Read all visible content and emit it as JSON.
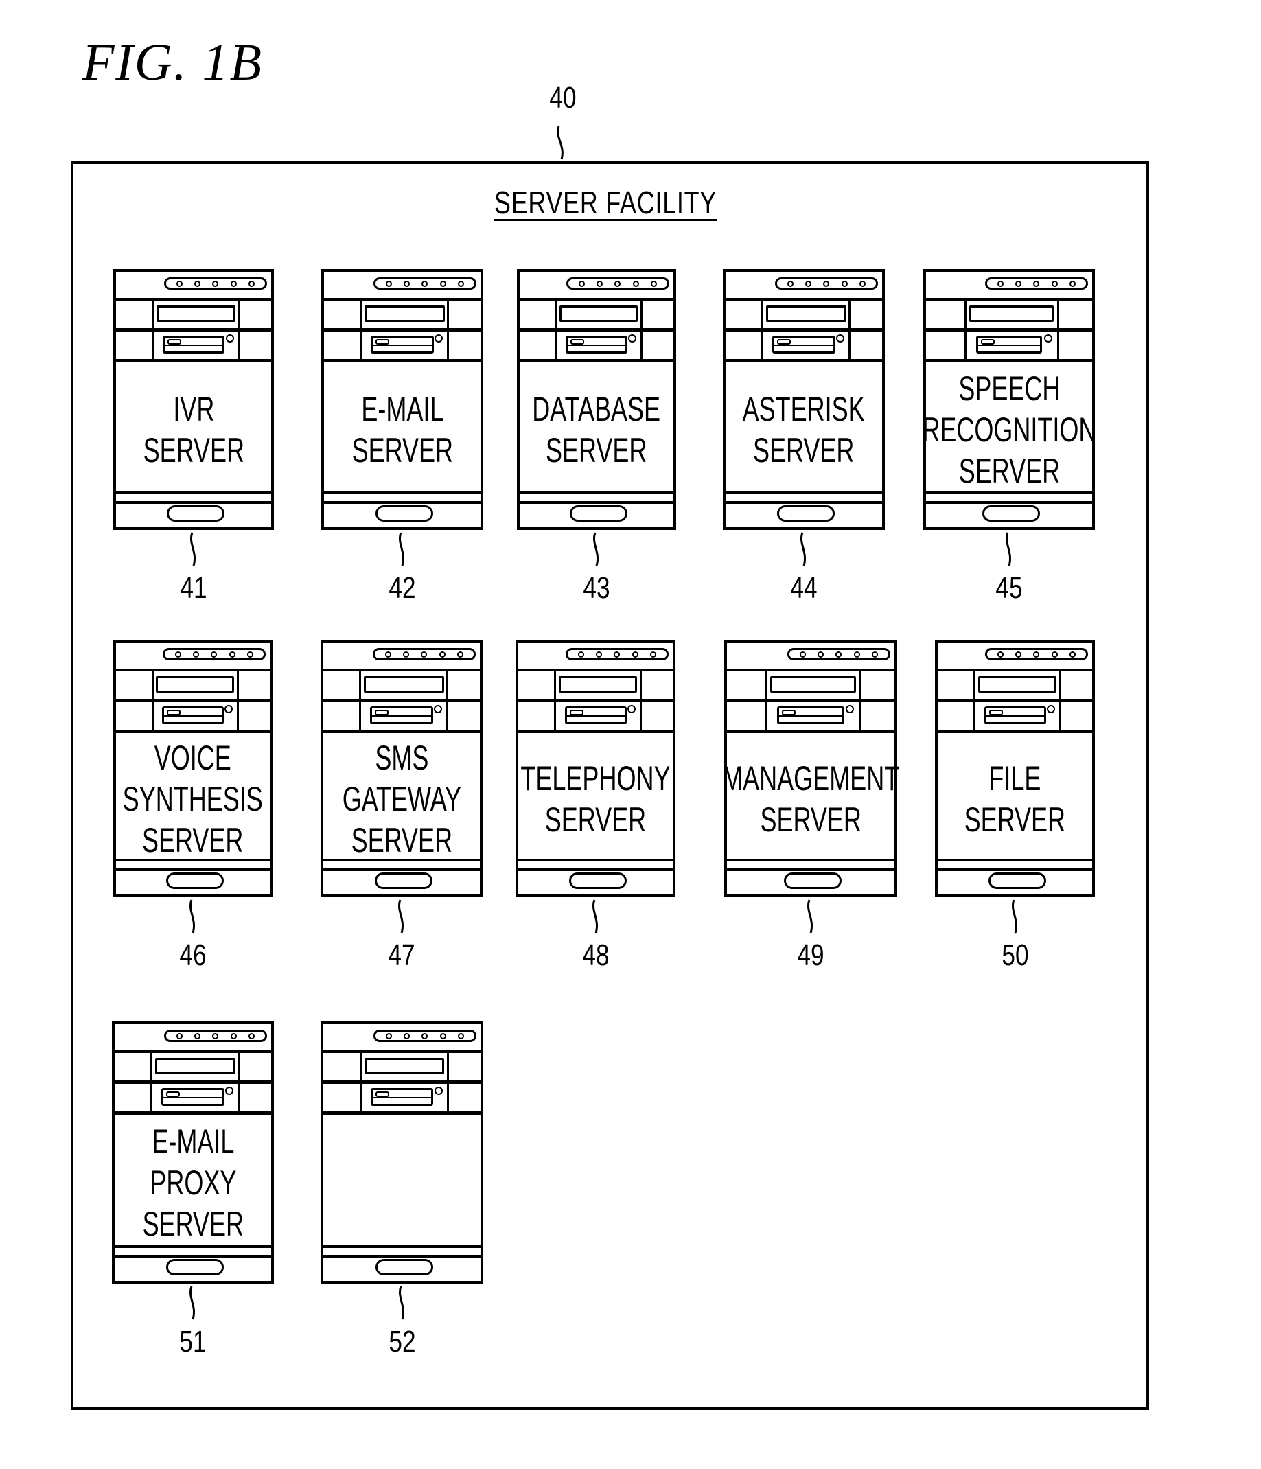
{
  "figure": {
    "title": "FIG. 1B",
    "facility": {
      "ref": "40",
      "title": "SERVER FACILITY"
    },
    "servers": [
      {
        "ref": "41",
        "label": "IVR\nSERVER"
      },
      {
        "ref": "42",
        "label": "E-MAIL\nSERVER"
      },
      {
        "ref": "43",
        "label": "DATABASE\nSERVER"
      },
      {
        "ref": "44",
        "label": "ASTERISK\nSERVER"
      },
      {
        "ref": "45",
        "label": "SPEECH\nRECOGNITION\nSERVER"
      },
      {
        "ref": "46",
        "label": "VOICE\nSYNTHESIS\nSERVER"
      },
      {
        "ref": "47",
        "label": "SMS\nGATEWAY\nSERVER"
      },
      {
        "ref": "48",
        "label": "TELEPHONY\nSERVER"
      },
      {
        "ref": "49",
        "label": "MANAGEMENT\nSERVER"
      },
      {
        "ref": "50",
        "label": "FILE\nSERVER"
      },
      {
        "ref": "51",
        "label": "E-MAIL\nPROXY\nSERVER"
      },
      {
        "ref": "52",
        "label": ""
      }
    ]
  }
}
